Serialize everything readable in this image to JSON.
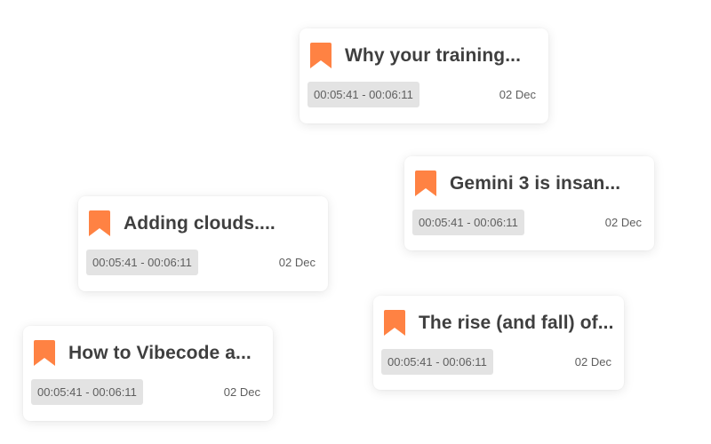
{
  "colors": {
    "accent": "#ff8243",
    "title_text": "#3f3f3f",
    "meta_text": "#5e5e5e",
    "timestamp_bg": "#e3e3e3"
  },
  "cards": [
    {
      "icon": "bookmark-icon",
      "title": "Why your training...",
      "timestamp": "00:05:41 - 00:06:11",
      "date": "02 Dec"
    },
    {
      "icon": "bookmark-icon",
      "title": "Gemini 3 is insan...",
      "timestamp": "00:05:41 - 00:06:11",
      "date": "02 Dec"
    },
    {
      "icon": "bookmark-icon",
      "title": "Adding clouds....",
      "timestamp": "00:05:41 - 00:06:11",
      "date": "02 Dec"
    },
    {
      "icon": "bookmark-icon",
      "title": "The rise (and fall) of...",
      "timestamp": "00:05:41 - 00:06:11",
      "date": "02 Dec"
    },
    {
      "icon": "bookmark-icon",
      "title": "How to Vibecode a...",
      "timestamp": "00:05:41 - 00:06:11",
      "date": "02 Dec"
    }
  ]
}
